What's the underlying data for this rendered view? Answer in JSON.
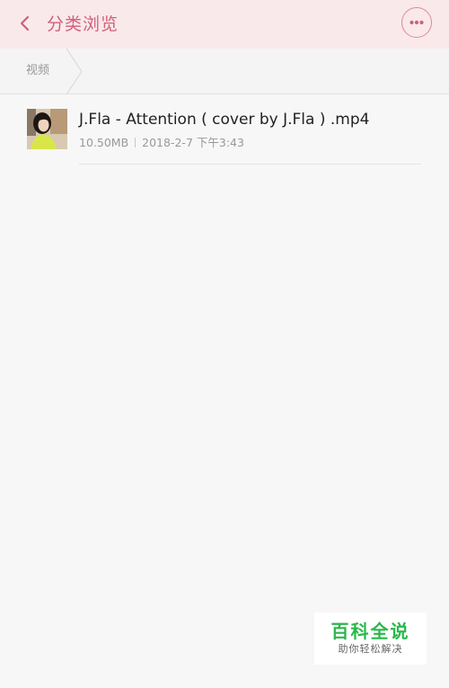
{
  "header": {
    "title": "分类浏览",
    "back_icon": "chevron-left-icon",
    "more_icon": "more-dots-icon",
    "accent_color": "#d0607a",
    "background_color": "#f9e9ea"
  },
  "breadcrumb": {
    "items": [
      "视频"
    ]
  },
  "files": [
    {
      "name": "J.Fla - Attention ( cover by J.Fla ) .mp4",
      "size": "10.50MB",
      "date": "2018-2-7 下午3:43",
      "thumbnail_icon": "video-thumbnail"
    }
  ],
  "watermark": {
    "title": "百科全说",
    "subtitle": "助你轻松解决",
    "color": "#2ab84a"
  }
}
